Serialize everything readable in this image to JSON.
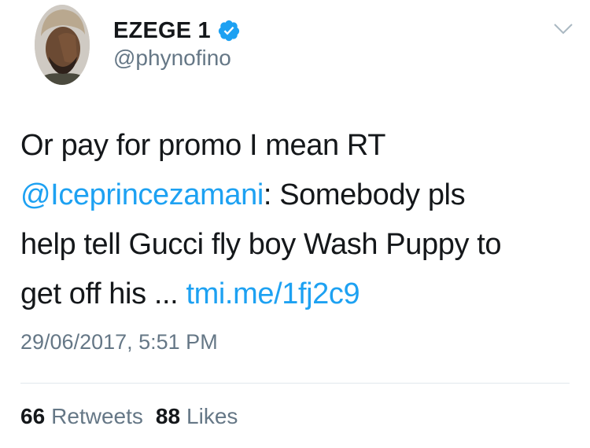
{
  "tweet": {
    "author": {
      "display_name": "EZEGE 1",
      "handle": "@phynofino",
      "verified": true,
      "avatar_icon": "person-avatar"
    },
    "text": {
      "line1": "Or pay for promo I mean RT",
      "mention": "@Iceprincezamani",
      "line2_rest": ": Somebody pls",
      "line3": "help tell Gucci fly boy Wash Puppy to",
      "line4": "get off his ... ",
      "link": "tmi.me/1fj2c9"
    },
    "timestamp": "29/06/2017, 5:51 PM",
    "stats": {
      "retweets_count": "66",
      "retweets_label": "Retweets",
      "likes_count": "88",
      "likes_label": "Likes"
    }
  },
  "colors": {
    "link": "#1da1f2",
    "secondary_text": "#657786",
    "primary_text": "#14171a",
    "divider": "#e1e8ed",
    "verified_badge": "#1da1f2"
  },
  "icons": {
    "verified": "verified-badge-icon",
    "menu": "chevron-down-icon"
  }
}
